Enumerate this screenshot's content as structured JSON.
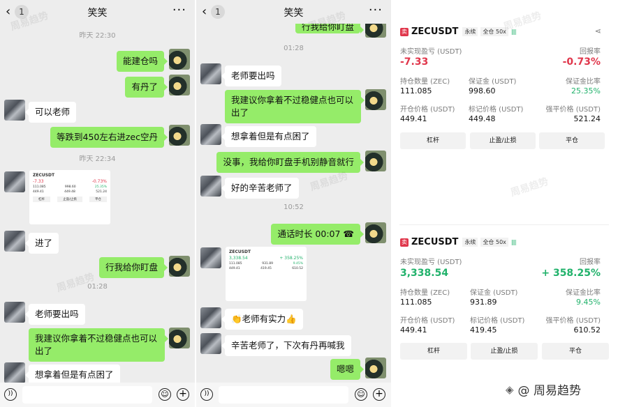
{
  "chat": {
    "title": "笑笑",
    "unread_count": "1",
    "more": "···",
    "icons": {
      "back": "back-chevron-icon",
      "more": "more-dots-icon",
      "voice": "voice-icon",
      "emoji": "emoji-icon",
      "plus": "plus-icon"
    }
  },
  "chat1": {
    "time1": "昨天 22:30",
    "m1": "能建仓吗",
    "m2": "有丹了",
    "m3": "可以老师",
    "m4": "等跌到450左右进zec空丹",
    "time2": "昨天 22:34",
    "m5": "进了",
    "m6": "行我给你盯盘",
    "time3": "01:28",
    "m7": "老师要出吗",
    "m8": "我建议你拿着不过稳健点也可以出了",
    "m9": "想拿着但是有点困了"
  },
  "chat2": {
    "m0": "行我给你盯盘",
    "time1": "01:28",
    "m1": "老师要出吗",
    "m2": "我建议你拿着不过稳健点也可以出了",
    "m3": "想拿着但是有点困了",
    "m4": "没事，我给你盯盘手机别静音就行",
    "m5": "好的辛苦老师了",
    "time2": "10:52",
    "m6": "通话时长 00:07",
    "m7": "👏老师有实力👍",
    "m8": "辛苦老师了，下次有丹再喊我",
    "m9": "嗯嗯"
  },
  "thumb1": {
    "symbol": "ZECUSDT",
    "pnl": "-7.33",
    "roe": "-0.73%",
    "size": "111.085",
    "margin": "998.60",
    "margin_ratio": "25.35%",
    "entry": "449.41",
    "mark": "449.48",
    "liq": "521.24",
    "b1": "杠杆",
    "b2": "止盈/止损",
    "b3": "平仓"
  },
  "thumb2": {
    "symbol": "ZECUSDT",
    "pnl": "3,338.54",
    "roe": "+ 358.25%",
    "size": "111.085",
    "margin": "931.89",
    "margin_ratio": "9.45%",
    "entry": "449.41",
    "mark": "419.45",
    "liq": "610.52"
  },
  "labels": {
    "sell": "卖",
    "perp": "永续",
    "cross": "全仓 50x",
    "bars": "||||",
    "pnl": "未实现盈亏 (USDT)",
    "roe": "回报率",
    "size": "持仓数量 (ZEC)",
    "margin": "保证金 (USDT)",
    "margin_ratio": "保证金比率",
    "entry": "开仓价格 (USDT)",
    "mark": "标记价格 (USDT)",
    "liq": "强平价格 (USDT)",
    "btn_leverage": "杠杆",
    "btn_tpsl": "止盈/止损",
    "btn_close": "平仓",
    "share_icon": "share-icon"
  },
  "card1": {
    "symbol": "ZECUSDT",
    "pnl": "-7.33",
    "roe": "-0.73%",
    "size": "111.085",
    "margin": "998.60",
    "margin_ratio": "25.35%",
    "entry": "449.41",
    "mark": "449.48",
    "liq": "521.24"
  },
  "card2": {
    "symbol": "ZECUSDT",
    "pnl": "3,338.54",
    "roe": "+ 358.25%",
    "size": "111.085",
    "margin": "931.89",
    "margin_ratio": "9.45%",
    "entry": "449.41",
    "mark": "419.45",
    "liq": "610.52"
  },
  "watermark": "周易趋势",
  "brand": "@ 周易趋势",
  "colors": {
    "green_bubble": "#95ec69",
    "red": "#e0364b",
    "green": "#21b26b"
  }
}
